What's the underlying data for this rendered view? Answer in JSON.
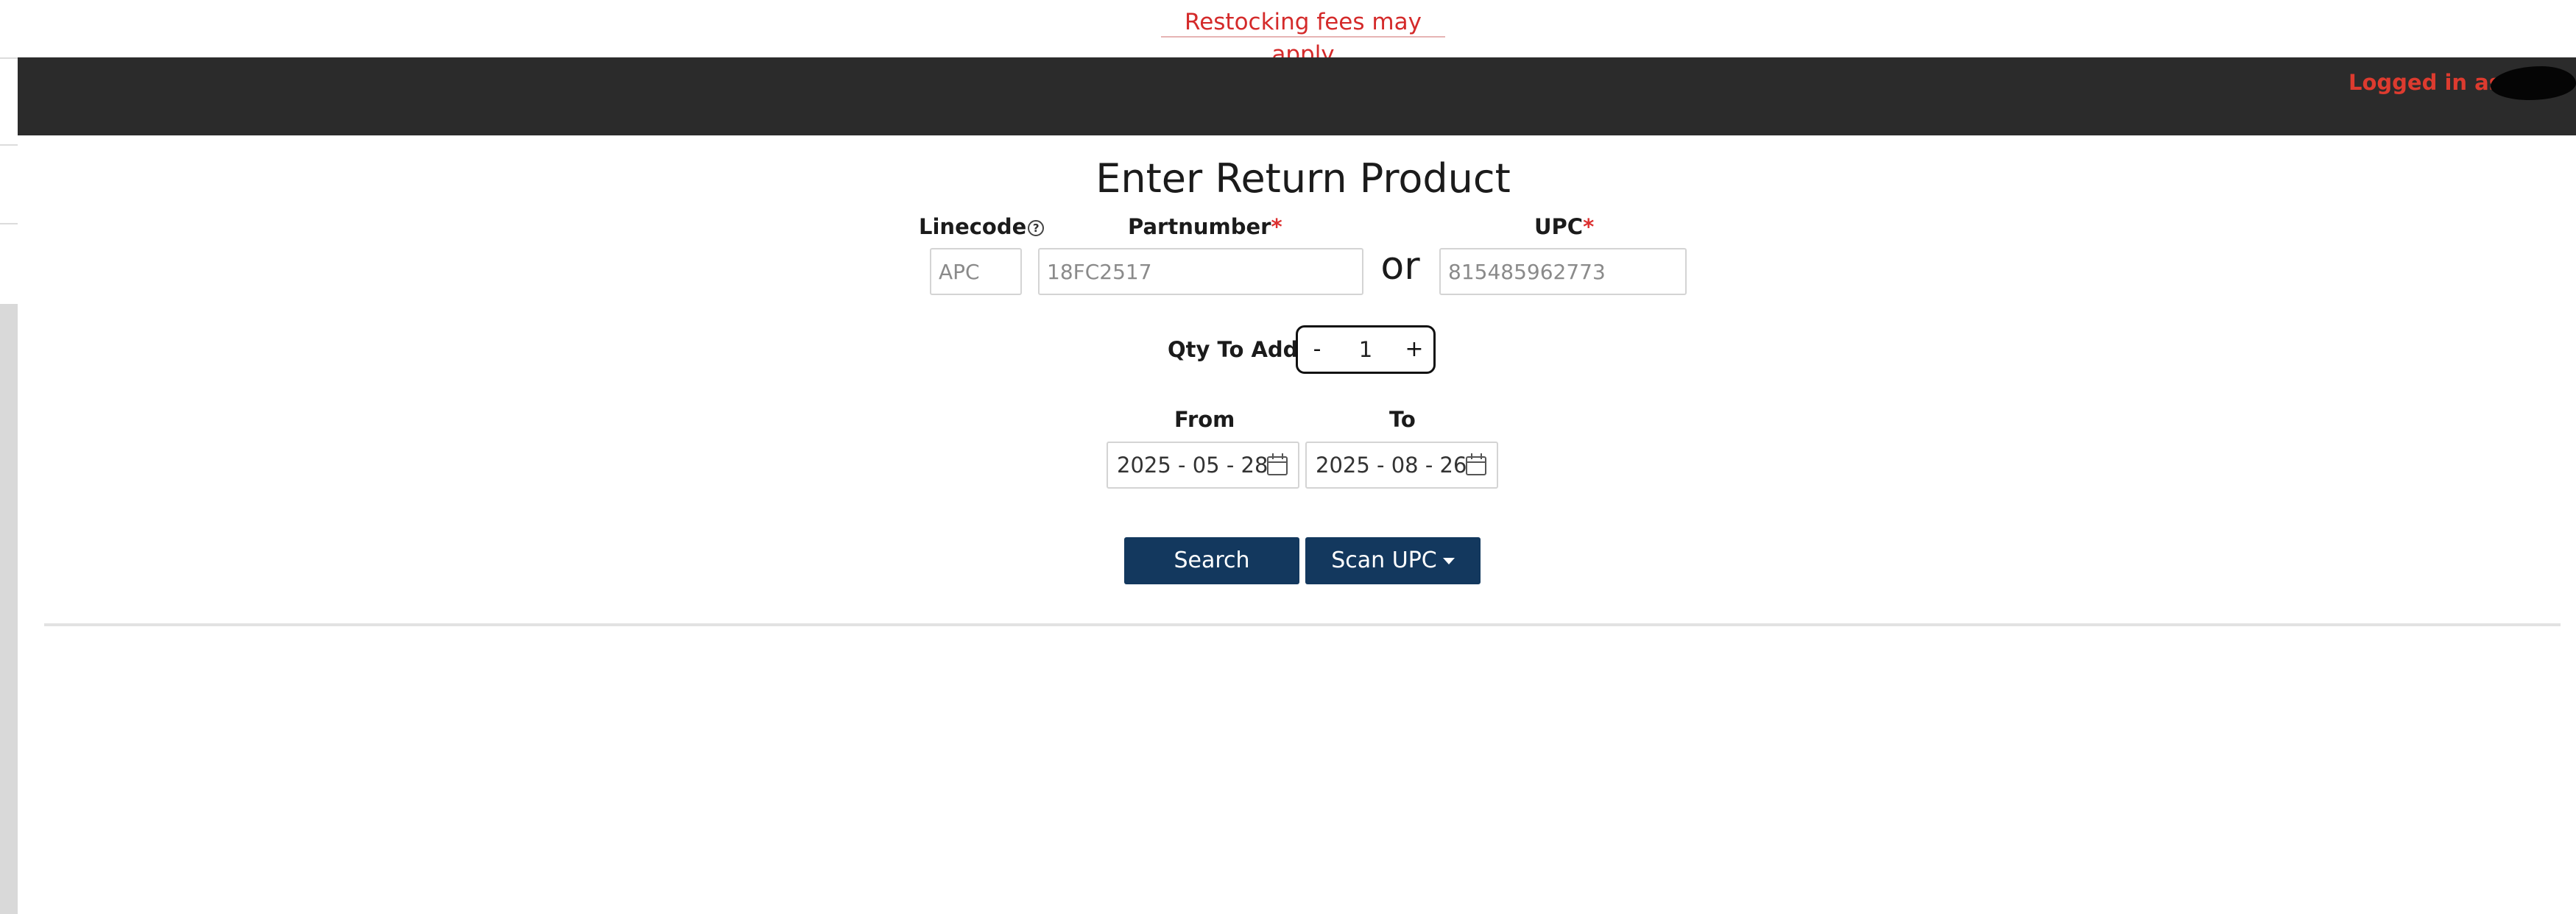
{
  "notice": "Restocking fees may apply",
  "header": {
    "logged_in_label": "Logged in as:"
  },
  "page_title": "Enter Return Product",
  "labels": {
    "linecode": "Linecode",
    "partnumber": "Partnumber",
    "upc": "UPC",
    "required_mark": "*",
    "or": "or",
    "qty": "Qty To Add",
    "from": "From",
    "to": "To"
  },
  "fields": {
    "linecode_placeholder": "APC",
    "partnumber_placeholder": "18FC2517",
    "upc_placeholder": "815485962773"
  },
  "qty": {
    "minus": "-",
    "value": "1",
    "plus": "+"
  },
  "dates": {
    "from": "2025 - 05 - 28",
    "to": "2025 - 08 - 26"
  },
  "buttons": {
    "search": "Search",
    "scan_upc": "Scan UPC"
  },
  "icons": {
    "help": "help-circle-icon",
    "calendar": "calendar-icon",
    "caret": "caret-down-icon"
  },
  "colors": {
    "accent": "#13385e",
    "header_bg": "#2b2b2b",
    "warning": "#d42a2a"
  }
}
